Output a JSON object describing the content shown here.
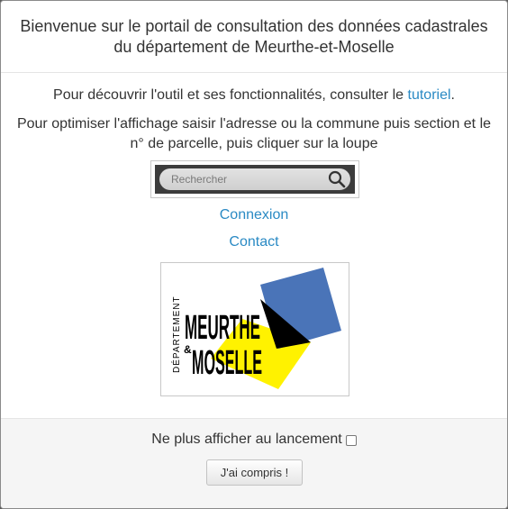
{
  "header": {
    "title": "Bienvenue sur le portail de consultation des données cadastrales du département de Meurthe-et-Moselle"
  },
  "body": {
    "intro_prefix": "Pour découvrir l'outil et ses fonctionnalités, consulter le ",
    "tutorial_link": "tutoriel",
    "intro_suffix": ".",
    "instructions": "Pour optimiser l'affichage saisir l'adresse ou la commune puis section et le n° de parcelle, puis cliquer sur la loupe"
  },
  "search": {
    "placeholder": "Rechercher",
    "icon": "magnifier-icon"
  },
  "links": {
    "login": "Connexion",
    "contact": "Contact"
  },
  "logo": {
    "line_department": "DÉPARTEMENT",
    "line_meurthe": "MEURTHE",
    "line_ampersand": "&",
    "line_moselle": "MOSELLE",
    "colors": {
      "blue": "#4a74b8",
      "yellow": "#fff200",
      "black": "#000000"
    }
  },
  "footer": {
    "checkbox_label": "Ne plus afficher au lancement",
    "checkbox_checked": false,
    "ok_button": "J'ai compris !"
  },
  "colors": {
    "link": "#2a8ac4",
    "text": "#333333",
    "backdrop": "#5a5a5a"
  }
}
